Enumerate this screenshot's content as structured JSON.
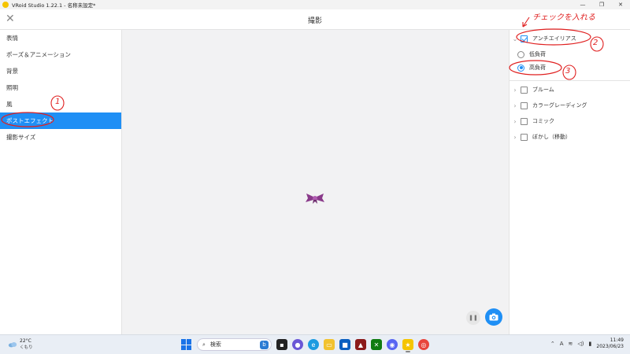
{
  "titlebar": {
    "title": "VRoid Studio 1.22.1 - 名称未設定*",
    "minimize": "—",
    "restore": "❐",
    "close": "✕"
  },
  "header": {
    "close_glyph": "✕",
    "title": "撮影"
  },
  "sidebar": {
    "items": [
      {
        "label": "表情",
        "active": false
      },
      {
        "label": "ポーズ＆アニメーション",
        "active": false
      },
      {
        "label": "背景",
        "active": false
      },
      {
        "label": "照明",
        "active": false
      },
      {
        "label": "風",
        "active": false
      },
      {
        "label": "ポストエフェクト",
        "active": true
      },
      {
        "label": "撮影サイズ",
        "active": false
      }
    ]
  },
  "viewport": {
    "pause_glyph": "❚❚"
  },
  "right_panel": {
    "antialias": {
      "label": "アンチエイリアス",
      "checked": true
    },
    "quality_options": [
      {
        "label": "低負荷",
        "selected": false
      },
      {
        "label": "高負荷",
        "selected": true
      }
    ],
    "effects": [
      {
        "label": "ブルーム",
        "checked": false
      },
      {
        "label": "カラーグレーディング",
        "checked": false
      },
      {
        "label": "コミック",
        "checked": false
      },
      {
        "label": "ぼかし（移動）",
        "checked": false
      }
    ]
  },
  "annotations": {
    "note": "チェックを入れる",
    "marker_1": "1",
    "marker_2": "2",
    "marker_3": "3",
    "color": "#e02020"
  },
  "taskbar": {
    "weather_temp": "22°C",
    "weather_desc": "くもり",
    "search_placeholder": "検索",
    "time": "11:49",
    "date": "2023/06/23",
    "ime": "A"
  },
  "colors": {
    "accent": "#1f8ff5"
  }
}
